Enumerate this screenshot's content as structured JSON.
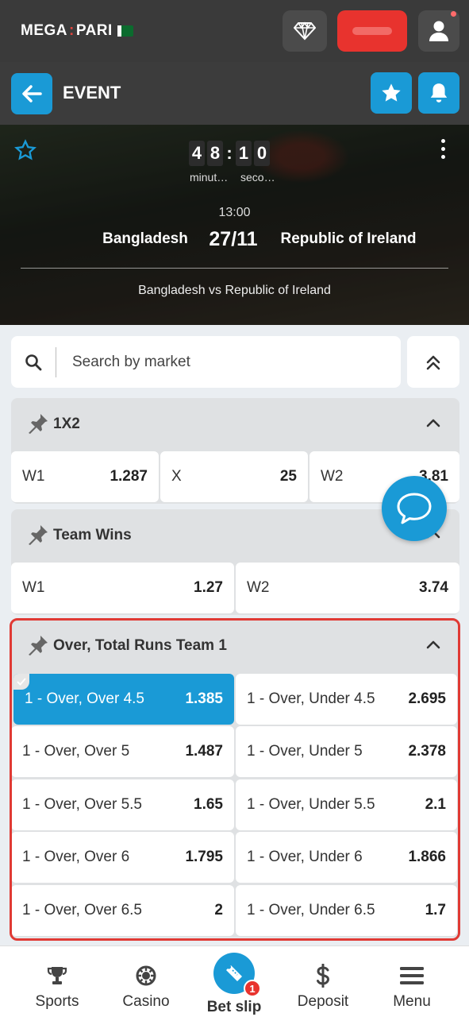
{
  "brand": {
    "logo_left": "MEGA",
    "logo_right": "PARI"
  },
  "topbar": {
    "icons": [
      "diamond-icon",
      "user-icon"
    ]
  },
  "event_bar": {
    "title": "EVENT"
  },
  "match": {
    "timer": {
      "digits": [
        "4",
        "8",
        "1",
        "0"
      ],
      "minutes_label": "minut…",
      "seconds_label": "seco…"
    },
    "time": "13:00",
    "team1": "Bangladesh",
    "date": "27/11",
    "team2": "Republic of Ireland",
    "matchup": "Bangladesh vs Republic of Ireland"
  },
  "search": {
    "placeholder": "Search by market"
  },
  "markets": [
    {
      "title": "1X2",
      "odds": [
        {
          "label": "W1",
          "value": "1.287"
        },
        {
          "label": "X",
          "value": "25"
        },
        {
          "label": "W2",
          "value": "3.81"
        }
      ]
    },
    {
      "title": "Team Wins",
      "odds": [
        {
          "label": "W1",
          "value": "1.27"
        },
        {
          "label": "W2",
          "value": "3.74"
        }
      ]
    },
    {
      "title": "Over, Total Runs Team 1",
      "odds": [
        {
          "label": "1 - Over, Over 4.5",
          "value": "1.385",
          "selected": true
        },
        {
          "label": "1 - Over, Under 4.5",
          "value": "2.695"
        },
        {
          "label": "1 - Over, Over 5",
          "value": "1.487"
        },
        {
          "label": "1 - Over, Under 5",
          "value": "2.378"
        },
        {
          "label": "1 - Over, Over 5.5",
          "value": "1.65"
        },
        {
          "label": "1 - Over, Under 5.5",
          "value": "2.1"
        },
        {
          "label": "1 - Over, Over 6",
          "value": "1.795"
        },
        {
          "label": "1 - Over, Under 6",
          "value": "1.866"
        },
        {
          "label": "1 - Over, Over 6.5",
          "value": "2"
        },
        {
          "label": "1 - Over, Under 6.5",
          "value": "1.7"
        }
      ]
    }
  ],
  "bottom_nav": {
    "sports": "Sports",
    "casino": "Casino",
    "bet_slip": "Bet slip",
    "bet_slip_count": "1",
    "deposit": "Deposit",
    "menu": "Menu"
  },
  "colors": {
    "accent": "#1a9ad6",
    "highlight": "#e03a34",
    "brand_red": "#e8332e"
  }
}
